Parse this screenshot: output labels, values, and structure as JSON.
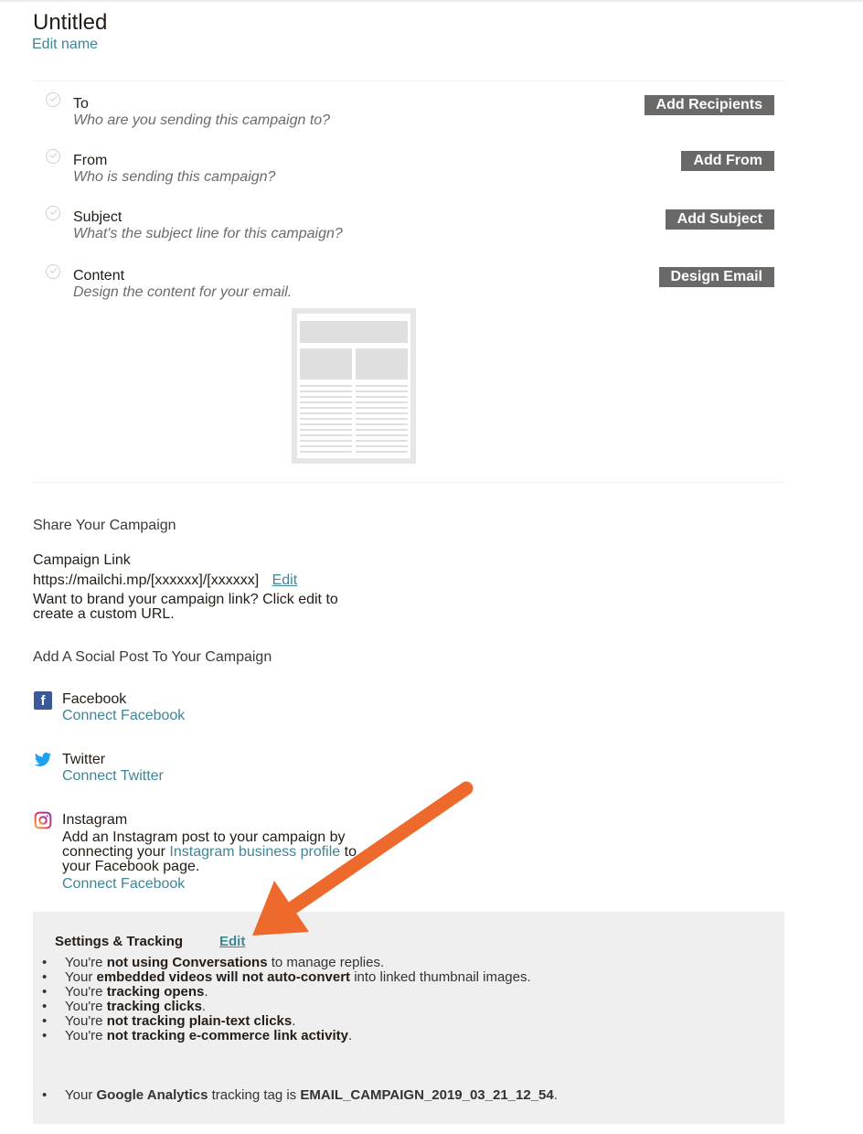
{
  "header": {
    "title": "Untitled",
    "edit_name": "Edit name"
  },
  "checklist": {
    "items": [
      {
        "label": "To",
        "description": "Who are you sending this campaign to?",
        "button": "Add Recipients"
      },
      {
        "label": "From",
        "description": "Who is sending this campaign?",
        "button": "Add From"
      },
      {
        "label": "Subject",
        "description": "What's the subject line for this campaign?",
        "button": "Add Subject"
      },
      {
        "label": "Content",
        "description": "Design the content for your email.",
        "button": "Design Email"
      }
    ]
  },
  "share": {
    "heading": "Share Your Campaign",
    "link_label": "Campaign Link",
    "link_url": "https://mailchi.mp/[xxxxxx]/[xxxxxx]",
    "link_edit": "Edit",
    "brand_text_1": "Want to brand your campaign link? Click edit to",
    "brand_text_2": "create a custom URL."
  },
  "social": {
    "heading": "Add A Social Post To Your Campaign",
    "facebook": {
      "name": "Facebook",
      "link": "Connect Facebook"
    },
    "twitter": {
      "name": "Twitter",
      "link": "Connect Twitter"
    },
    "instagram": {
      "name": "Instagram",
      "text_1": "Add an Instagram post to your campaign by",
      "text_2_pre": "connecting your ",
      "text_2_link": "Instagram business profile",
      "text_2_post": " to",
      "text_3": "your Facebook page.",
      "link": "Connect Facebook"
    }
  },
  "settings": {
    "title": "Settings & Tracking",
    "edit": "Edit",
    "items": [
      {
        "pre": "You're ",
        "bold": "not using Conversations",
        "post": " to manage replies."
      },
      {
        "pre": "Your ",
        "bold": "embedded videos will not auto-convert",
        "post": " into linked thumbnail images."
      },
      {
        "pre": "You're ",
        "bold": "tracking opens",
        "post": "."
      },
      {
        "pre": "You're ",
        "bold": "tracking clicks",
        "post": "."
      },
      {
        "pre": "You're ",
        "bold": "not tracking plain-text clicks",
        "post": "."
      },
      {
        "pre": "You're ",
        "bold": "not tracking e-commerce link activity",
        "post": "."
      }
    ],
    "ga": {
      "pre": "Your ",
      "bold1": "Google Analytics",
      "mid": " tracking tag is ",
      "bold2": "EMAIL_CAMPAIGN_2019_03_21_12_54",
      "post": "."
    }
  },
  "colors": {
    "accent_link": "#3e8696",
    "button_bg": "#6b6968",
    "annotation_arrow": "#ee6a2c",
    "facebook_blue": "#3b5998",
    "twitter_blue": "#1da1f2"
  }
}
